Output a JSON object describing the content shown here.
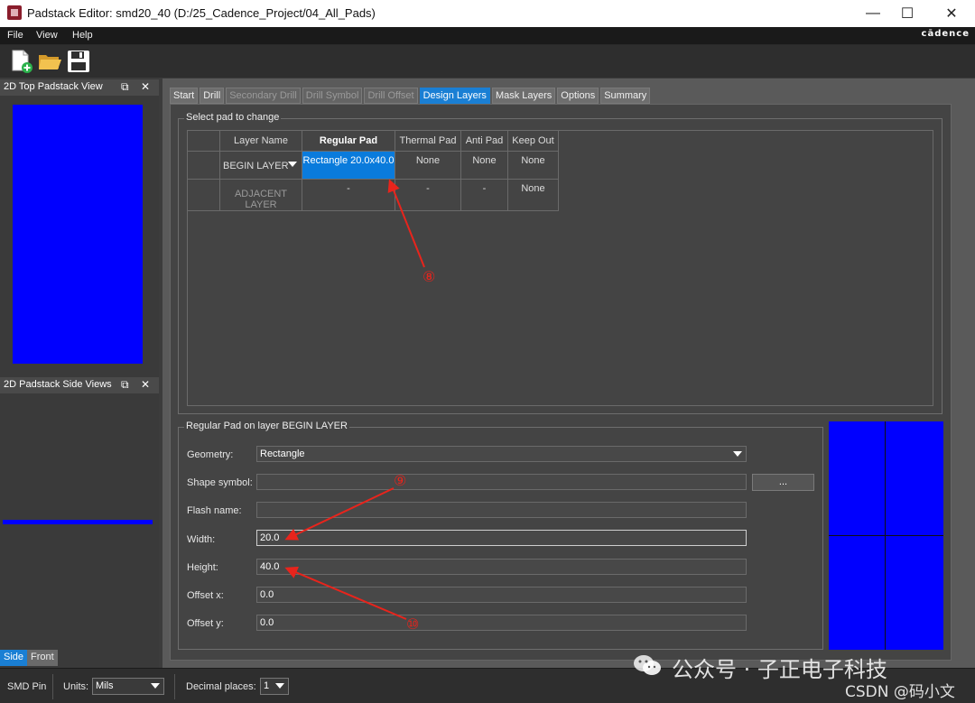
{
  "window": {
    "title": "Padstack Editor: smd20_40  (D:/25_Cadence_Project/04_All_Pads)",
    "controls": {
      "minimize": "—",
      "maximize": "☐",
      "close": "✕"
    }
  },
  "menu": {
    "items": [
      "File",
      "View",
      "Help"
    ],
    "brand": "cādence"
  },
  "toolbar": {
    "icons": [
      "new-file-icon",
      "open-folder-icon",
      "save-icon"
    ]
  },
  "left_panels": {
    "top_view_title": "2D Top Padstack View",
    "side_view_title": "2D Padstack Side Views",
    "float_glyph": "⧉",
    "close_glyph": "✕",
    "bottom_tabs": [
      "Side",
      "Front"
    ]
  },
  "tabs": [
    {
      "label": "Start",
      "state": "normal"
    },
    {
      "label": "Drill",
      "state": "normal"
    },
    {
      "label": "Secondary Drill",
      "state": "disabled"
    },
    {
      "label": "Drill Symbol",
      "state": "disabled"
    },
    {
      "label": "Drill Offset",
      "state": "disabled"
    },
    {
      "label": "Design Layers",
      "state": "active"
    },
    {
      "label": "Mask Layers",
      "state": "normal"
    },
    {
      "label": "Options",
      "state": "normal"
    },
    {
      "label": "Summary",
      "state": "normal"
    }
  ],
  "pad_table": {
    "group_title": "Select pad to change",
    "headers": [
      "Layer Name",
      "Regular Pad",
      "Thermal Pad",
      "Anti Pad",
      "Keep Out"
    ],
    "rows": [
      {
        "layer": "BEGIN LAYER",
        "regular": "Rectangle 20.0x40.0",
        "thermal": "None",
        "anti": "None",
        "keepout": "None"
      },
      {
        "layer": "ADJACENT LAYER",
        "regular": "-",
        "thermal": "-",
        "anti": "-",
        "keepout": "None"
      }
    ]
  },
  "pad_form": {
    "group_title": "Regular Pad on layer BEGIN LAYER",
    "geometry_label": "Geometry:",
    "geometry_value": "Rectangle",
    "shape_symbol_label": "Shape symbol:",
    "shape_symbol_value": "",
    "browse_label": "...",
    "flash_name_label": "Flash name:",
    "flash_name_value": "",
    "width_label": "Width:",
    "width_value": "20.0",
    "height_label": "Height:",
    "height_value": "40.0",
    "offset_x_label": "Offset x:",
    "offset_x_value": "0.0",
    "offset_y_label": "Offset y:",
    "offset_y_value": "0.0"
  },
  "status": {
    "pin_type": "SMD Pin",
    "units_label": "Units:",
    "units_value": "Mils",
    "decimal_label": "Decimal places:",
    "decimal_value": "1"
  },
  "annotations": {
    "n8": "⑧",
    "n9": "⑨",
    "n10": "⑩"
  },
  "watermark": {
    "line1": "公众号 · 子正电子科技",
    "line2": "CSDN @码小文"
  },
  "colors": {
    "accent": "#0a7bdc",
    "pad_fill": "#0000ff",
    "annotation": "#e8241c"
  }
}
